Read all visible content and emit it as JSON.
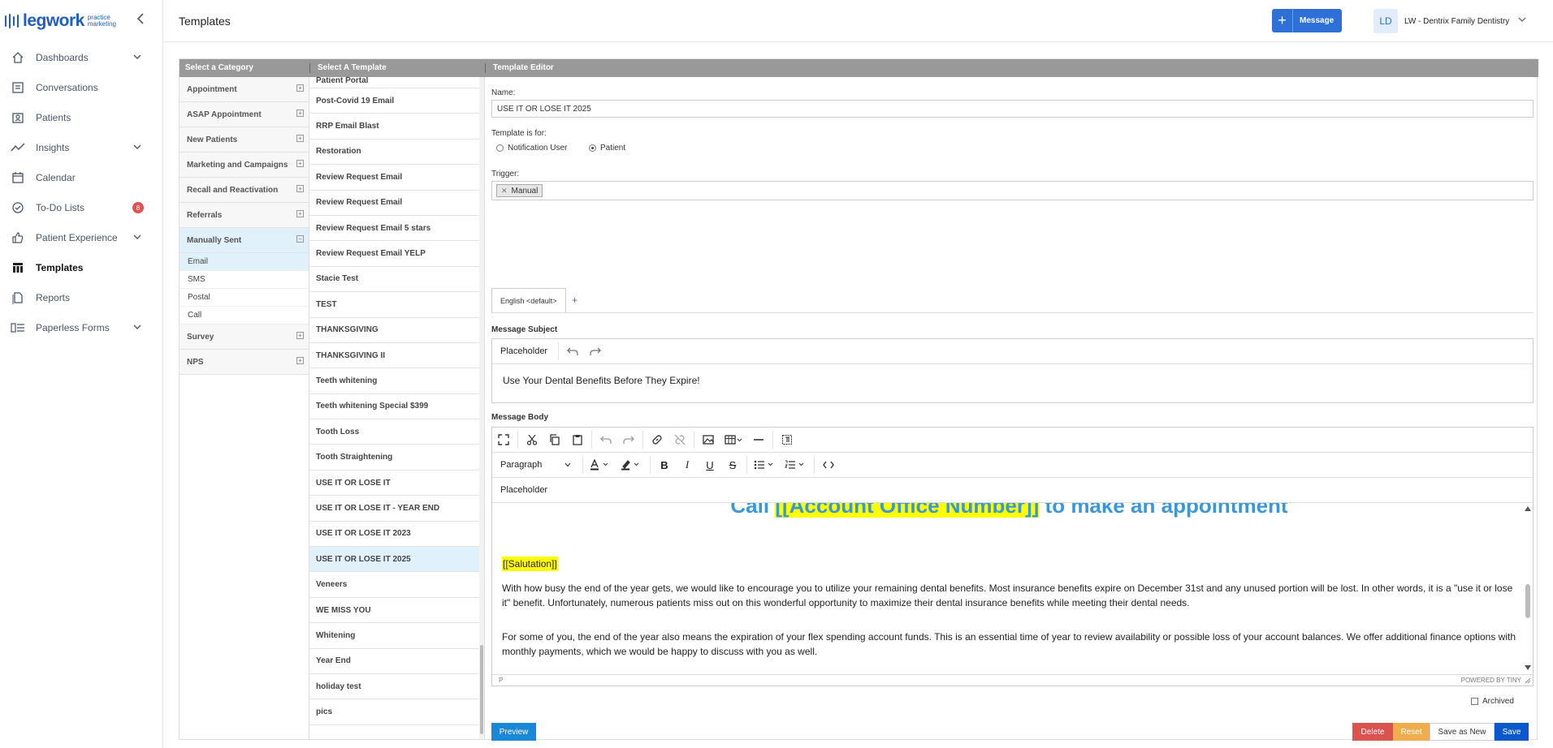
{
  "brand": {
    "word": "legwork",
    "sub": "practice marketing",
    "color": "#1f5fbf"
  },
  "nav": [
    {
      "label": "Dashboards",
      "icon": "home-icon",
      "chevron": true
    },
    {
      "label": "Conversations",
      "icon": "chat-list-icon",
      "chevron": false
    },
    {
      "label": "Patients",
      "icon": "patient-card-icon",
      "chevron": false
    },
    {
      "label": "Insights",
      "icon": "trend-line-icon",
      "chevron": true
    },
    {
      "label": "Calendar",
      "icon": "calendar-icon",
      "chevron": false
    },
    {
      "label": "To-Do Lists",
      "icon": "check-circle-icon",
      "chevron": false,
      "badge": "8"
    },
    {
      "label": "Patient Experience",
      "icon": "thumbs-up-icon",
      "chevron": true
    },
    {
      "label": "Templates",
      "icon": "table-icon",
      "chevron": false,
      "active": true
    },
    {
      "label": "Reports",
      "icon": "document-icon",
      "chevron": false
    },
    {
      "label": "Paperless Forms",
      "icon": "form-list-icon",
      "chevron": true
    }
  ],
  "header": {
    "title": "Templates",
    "message_button": "Message",
    "avatar_initials": "LD",
    "account_name": "LW - Dentrix Family Dentistry"
  },
  "panel_head": {
    "categories": "Select a Category",
    "templates": "Select A Template",
    "editor": "Template Editor"
  },
  "categories": [
    {
      "label": "Appointment",
      "toggle": "+"
    },
    {
      "label": "ASAP Appointment",
      "toggle": "+"
    },
    {
      "label": "New Patients",
      "toggle": "+"
    },
    {
      "label": "Marketing and Campaigns",
      "toggle": "+"
    },
    {
      "label": "Recall and Reactivation",
      "toggle": "+"
    },
    {
      "label": "Referrals",
      "toggle": "+"
    },
    {
      "label": "Manually Sent",
      "toggle": "−",
      "open": true,
      "children": [
        "Email",
        "SMS",
        "Postal",
        "Call"
      ]
    },
    {
      "label": "Survey",
      "toggle": "+"
    },
    {
      "label": "NPS",
      "toggle": "+"
    }
  ],
  "templates": {
    "first_partial": "Patient Portal",
    "items": [
      "Post-Covid 19 Email",
      "RRP Email Blast",
      "Restoration",
      "Review Request Email",
      "Review Request Email",
      "Review Request Email 5 stars",
      "Review Request Email YELP",
      "Stacie Test",
      "TEST",
      "THANKSGIVING",
      "THANKSGIVING II",
      "Teeth whitening",
      "Teeth whitening Special $399",
      "Tooth Loss",
      "Tooth Straightening",
      "USE IT OR LOSE IT",
      "USE IT OR LOSE IT - YEAR END",
      "USE IT OR LOSE IT 2023",
      "USE IT OR LOSE IT 2025",
      "Veneers",
      "WE MISS YOU",
      "Whitening",
      "Year End",
      "holiday test",
      "pics"
    ],
    "selected": "USE IT OR LOSE IT 2025"
  },
  "editor": {
    "name_label": "Name:",
    "name_value": "USE IT OR LOSE IT 2025",
    "template_for_label": "Template is for:",
    "radio_notification": "Notification User",
    "radio_patient": "Patient",
    "trigger_label": "Trigger:",
    "trigger_chip": "Manual",
    "tab_default": "English <default>",
    "tab_add": "+",
    "subject_label": "Message Subject",
    "subject_placeholder": "Placeholder",
    "subject_value": "Use Your Dental Benefits Before They Expire!",
    "body_label": "Message Body",
    "paragraph_select": "Paragraph",
    "body_placeholder": "Placeholder",
    "call_prefix": "Call ",
    "call_merge": "[[Account Office Number]]",
    "call_suffix": " to make an appointment",
    "salutation": "[[Salutation]]",
    "para1": "With how busy the end of the year gets, we would like to encourage you to utilize your remaining dental benefits. Most insurance benefits expire on December 31st and any unused portion will be lost. In other words, it is a \"use it or lose it\" benefit. Unfortunately, numerous patients miss out on this wonderful opportunity to maximize their dental insurance benefits while meeting their dental needs.",
    "para2": "For some of you, the end of the year also means the expiration of your flex spending account funds. This is an essential time of year to review availability or possible loss of your account balances. We offer additional finance options with monthly payments, which we would be happy to discuss with you as well.",
    "status_path": "P",
    "powered_by": "POWERED BY TINY",
    "archived_label": "Archived"
  },
  "actions": {
    "preview": "Preview",
    "delete": "Delete",
    "reset": "Reset",
    "save_as_new": "Save as New",
    "save": "Save"
  },
  "colors": {
    "accent": "#2e6fd8",
    "delete": "#d9534f",
    "reset": "#f0ad4e",
    "save": "#0a58ca",
    "preview": "#1a88d8",
    "badge": "#e05252",
    "selected_row": "#e1f1fb",
    "merge_highlight": "#ffff00"
  }
}
